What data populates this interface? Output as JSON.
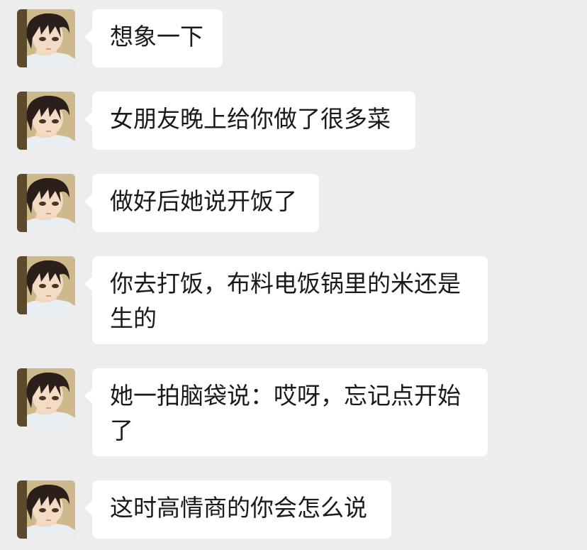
{
  "messages": [
    {
      "text": "想象一下"
    },
    {
      "text": "女朋友晚上给你做了很多菜"
    },
    {
      "text": "做好后她说开饭了"
    },
    {
      "text": "你去打饭，布料电饭锅里的米还是生的"
    },
    {
      "text": "她一拍脑袋说：哎呀，忘记点开始了"
    },
    {
      "text": "这时高情商的你会怎么说"
    }
  ],
  "colors": {
    "background": "#ededed",
    "bubble": "#ffffff",
    "text": "#1a1a1a"
  },
  "avatar_icon": "anime-boy-avatar"
}
